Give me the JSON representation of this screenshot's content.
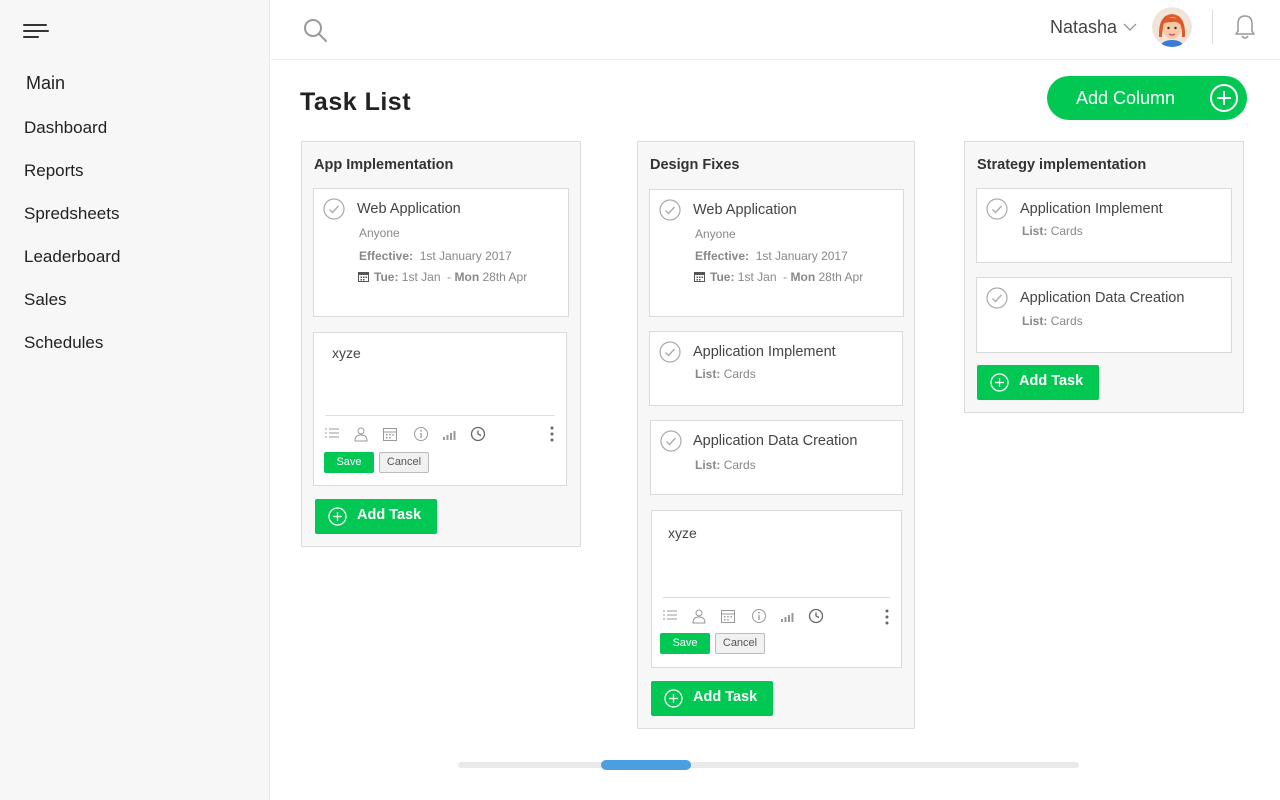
{
  "sidebar": {
    "title": "Main",
    "items": [
      {
        "label": "Dashboard"
      },
      {
        "label": "Reports"
      },
      {
        "label": "Spredsheets"
      },
      {
        "label": "Leaderboard"
      },
      {
        "label": "Sales"
      },
      {
        "label": "Schedules"
      }
    ]
  },
  "header": {
    "user_name": "Natasha"
  },
  "page": {
    "title": "Task List",
    "add_column_label": "Add Column"
  },
  "columns": [
    {
      "title": "App Implementation",
      "cards": [
        {
          "title": "Web Application",
          "assignee": "Anyone",
          "effective_label": "Effective:",
          "effective_value": "1st January 2017",
          "start_day": "Tue:",
          "start_date": "1st Jan",
          "end_day": "Mon",
          "end_date": "28th Apr"
        }
      ],
      "editor": {
        "text": "xyze",
        "save_label": "Save",
        "cancel_label": "Cancel"
      },
      "add_task_label": "Add Task"
    },
    {
      "title": "Design Fixes",
      "cards": [
        {
          "title": "Web Application",
          "assignee": "Anyone",
          "effective_label": "Effective:",
          "effective_value": "1st January 2017",
          "start_day": "Tue:",
          "start_date": "1st Jan",
          "end_day": "Mon",
          "end_date": "28th Apr"
        },
        {
          "title": "Application Implement",
          "list_label": "List:",
          "list_value": "Cards"
        },
        {
          "title": "Application Data Creation",
          "list_label": "List:",
          "list_value": "Cards"
        }
      ],
      "editor": {
        "text": "xyze",
        "save_label": "Save",
        "cancel_label": "Cancel"
      },
      "add_task_label": "Add Task"
    },
    {
      "title": "Strategy implementation",
      "cards": [
        {
          "title": "Application Implement",
          "list_label": "List:",
          "list_value": "Cards"
        },
        {
          "title": "Application Data Creation",
          "list_label": "List:",
          "list_value": "Cards"
        }
      ],
      "add_task_label": "Add Task"
    }
  ],
  "colors": {
    "accent_green": "#00c853",
    "scroll_thumb": "#4a9fe2",
    "sidebar_bg": "#f7f7f7"
  },
  "icons": [
    "menu-icon",
    "search-icon",
    "chevron-down-icon",
    "bell-icon",
    "plus-circle-icon",
    "check-circle-icon",
    "calendar-icon",
    "list-icon",
    "user-icon",
    "info-icon",
    "signal-icon",
    "clock-icon",
    "more-vertical-icon"
  ]
}
